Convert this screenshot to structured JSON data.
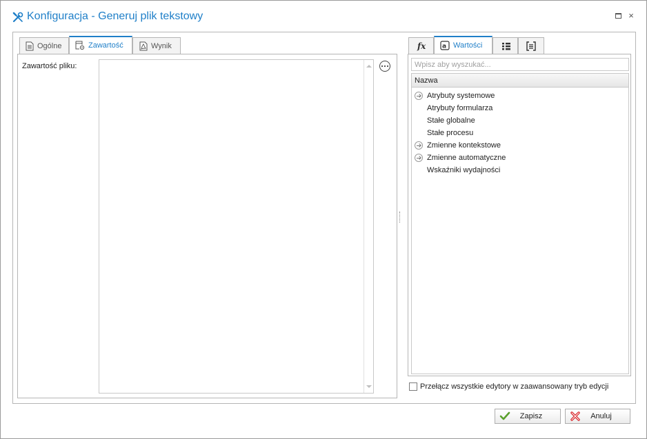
{
  "window": {
    "title": "Konfiguracja - Generuj plik tekstowy",
    "maximize_label": "",
    "close_label": "×"
  },
  "left_tabs": [
    {
      "label": "Ogólne",
      "icon": "document-icon",
      "active": false
    },
    {
      "label": "Zawartość",
      "icon": "file-settings-icon",
      "active": true
    },
    {
      "label": "Wynik",
      "icon": "pdf-file-icon",
      "active": false
    }
  ],
  "content": {
    "label": "Zawartość pliku:",
    "value": ""
  },
  "right_tabs": [
    {
      "label": "",
      "icon": "function-fx-icon",
      "active": false
    },
    {
      "label": "Wartości",
      "icon": "at-sign-icon",
      "active": true
    },
    {
      "label": "",
      "icon": "list-icon",
      "active": false
    },
    {
      "label": "",
      "icon": "brackets-icon",
      "active": false
    }
  ],
  "search": {
    "placeholder": "Wpisz aby wyszukać...",
    "value": ""
  },
  "values_list": {
    "header": "Nazwa",
    "items": [
      {
        "label": "Atrybuty systemowe",
        "expandable": true
      },
      {
        "label": "Atrybuty formularza",
        "expandable": false
      },
      {
        "label": "Stałe globalne",
        "expandable": false
      },
      {
        "label": "Stałe procesu",
        "expandable": false
      },
      {
        "label": "Zmienne kontekstowe",
        "expandable": true
      },
      {
        "label": "Zmienne automatyczne",
        "expandable": true
      },
      {
        "label": "Wskaźniki wydajności",
        "expandable": false
      }
    ]
  },
  "advanced_mode": {
    "label": "Przełącz wszystkie edytory w zaawansowany tryb edycji",
    "checked": false
  },
  "buttons": {
    "save": "Zapisz",
    "cancel": "Anuluj"
  },
  "colors": {
    "accent": "#1f7fc8",
    "save_check": "#5aa02c",
    "cancel_x": "#d9262b"
  }
}
